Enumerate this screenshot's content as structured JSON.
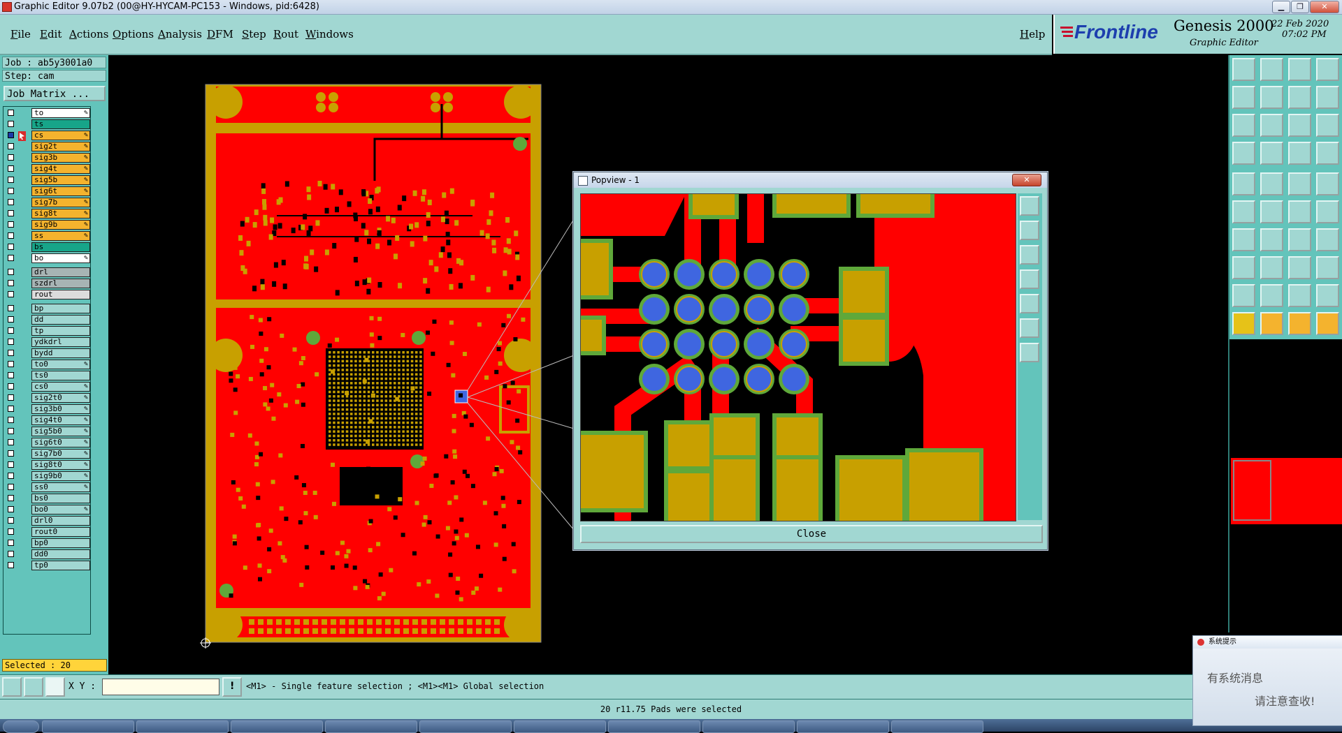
{
  "window": {
    "title": "Graphic Editor 9.07b2 (00@HY-HYCAM-PC153 - Windows, pid:6428)"
  },
  "menu": {
    "items": [
      "File",
      "Edit",
      "Actions",
      "Options",
      "Analysis",
      "DFM",
      "Step",
      "Rout",
      "Windows"
    ],
    "help": "Help"
  },
  "brand": {
    "logo": "Frontline",
    "product": "Genesis 2000",
    "subtitle": "Graphic Editor",
    "date": "22 Feb 2020",
    "time": "07:02 PM"
  },
  "job": {
    "job_line": "Job : ab5y3001a0",
    "step_line": "Step: cam",
    "matrix_button": "Job Matrix ..."
  },
  "layers": [
    {
      "name": "to",
      "color": "#ffffff",
      "pen": true
    },
    {
      "name": "ts",
      "color": "#17a589",
      "pen": false
    },
    {
      "name": "cs",
      "color": "#f4b32e",
      "pen": true,
      "active": true
    },
    {
      "name": "sig2t",
      "color": "#f4b32e",
      "pen": true
    },
    {
      "name": "sig3b",
      "color": "#f4b32e",
      "pen": true
    },
    {
      "name": "sig4t",
      "color": "#f4b32e",
      "pen": true
    },
    {
      "name": "sig5b",
      "color": "#f4b32e",
      "pen": true
    },
    {
      "name": "sig6t",
      "color": "#f4b32e",
      "pen": true
    },
    {
      "name": "sig7b",
      "color": "#f4b32e",
      "pen": true
    },
    {
      "name": "sig8t",
      "color": "#f4b32e",
      "pen": true
    },
    {
      "name": "sig9b",
      "color": "#f4b32e",
      "pen": true
    },
    {
      "name": "ss",
      "color": "#f4b32e",
      "pen": true
    },
    {
      "name": "bs",
      "color": "#17a589",
      "pen": false
    },
    {
      "name": "bo",
      "color": "#ffffff",
      "pen": true
    },
    {
      "name": "drl",
      "color": "#a7b4b4",
      "pen": false,
      "gap": true
    },
    {
      "name": "szdrl",
      "color": "#a7b4b4",
      "pen": false
    },
    {
      "name": "rout",
      "color": "#dcdcdc",
      "pen": false
    },
    {
      "name": "bp",
      "color": "#a1d7d2",
      "pen": false,
      "gap": true
    },
    {
      "name": "dd",
      "color": "#a1d7d2",
      "pen": false
    },
    {
      "name": "tp",
      "color": "#a1d7d2",
      "pen": false
    },
    {
      "name": "ydkdrl",
      "color": "#a1d7d2",
      "pen": false
    },
    {
      "name": "bydd",
      "color": "#a1d7d2",
      "pen": false
    },
    {
      "name": "to0",
      "color": "#a1d7d2",
      "pen": true
    },
    {
      "name": "ts0",
      "color": "#a1d7d2",
      "pen": false
    },
    {
      "name": "cs0",
      "color": "#a1d7d2",
      "pen": true
    },
    {
      "name": "sig2t0",
      "color": "#a1d7d2",
      "pen": true
    },
    {
      "name": "sig3b0",
      "color": "#a1d7d2",
      "pen": true
    },
    {
      "name": "sig4t0",
      "color": "#a1d7d2",
      "pen": true
    },
    {
      "name": "sig5b0",
      "color": "#a1d7d2",
      "pen": true
    },
    {
      "name": "sig6t0",
      "color": "#a1d7d2",
      "pen": true
    },
    {
      "name": "sig7b0",
      "color": "#a1d7d2",
      "pen": true
    },
    {
      "name": "sig8t0",
      "color": "#a1d7d2",
      "pen": true
    },
    {
      "name": "sig9b0",
      "color": "#a1d7d2",
      "pen": true
    },
    {
      "name": "ss0",
      "color": "#a1d7d2",
      "pen": true
    },
    {
      "name": "bs0",
      "color": "#a1d7d2",
      "pen": false
    },
    {
      "name": "bo0",
      "color": "#a1d7d2",
      "pen": true
    },
    {
      "name": "drl0",
      "color": "#a1d7d2",
      "pen": false
    },
    {
      "name": "rout0",
      "color": "#a1d7d2",
      "pen": false
    },
    {
      "name": "bp0",
      "color": "#a1d7d2",
      "pen": false
    },
    {
      "name": "dd0",
      "color": "#a1d7d2",
      "pen": false
    },
    {
      "name": "tp0",
      "color": "#a1d7d2",
      "pen": false
    }
  ],
  "selected": "Selected : 20",
  "popview": {
    "title": "Popview - 1",
    "close_label": "Close"
  },
  "coords": {
    "label": "X Y :",
    "value": ""
  },
  "hint": "<M1> - Single feature selection ; <M1><M1> Global selection",
  "status": "20 r11.75 Pads were selected",
  "notice": {
    "header": "系统提示",
    "line1": "有系统消息",
    "line2": "请注意查收!"
  },
  "colors": {
    "copper": "#ff0000",
    "pad": "#c8a000",
    "selected_pad": "#3f66e0",
    "panel": "#a1d7d2",
    "panel_dark": "#63c4bb"
  }
}
